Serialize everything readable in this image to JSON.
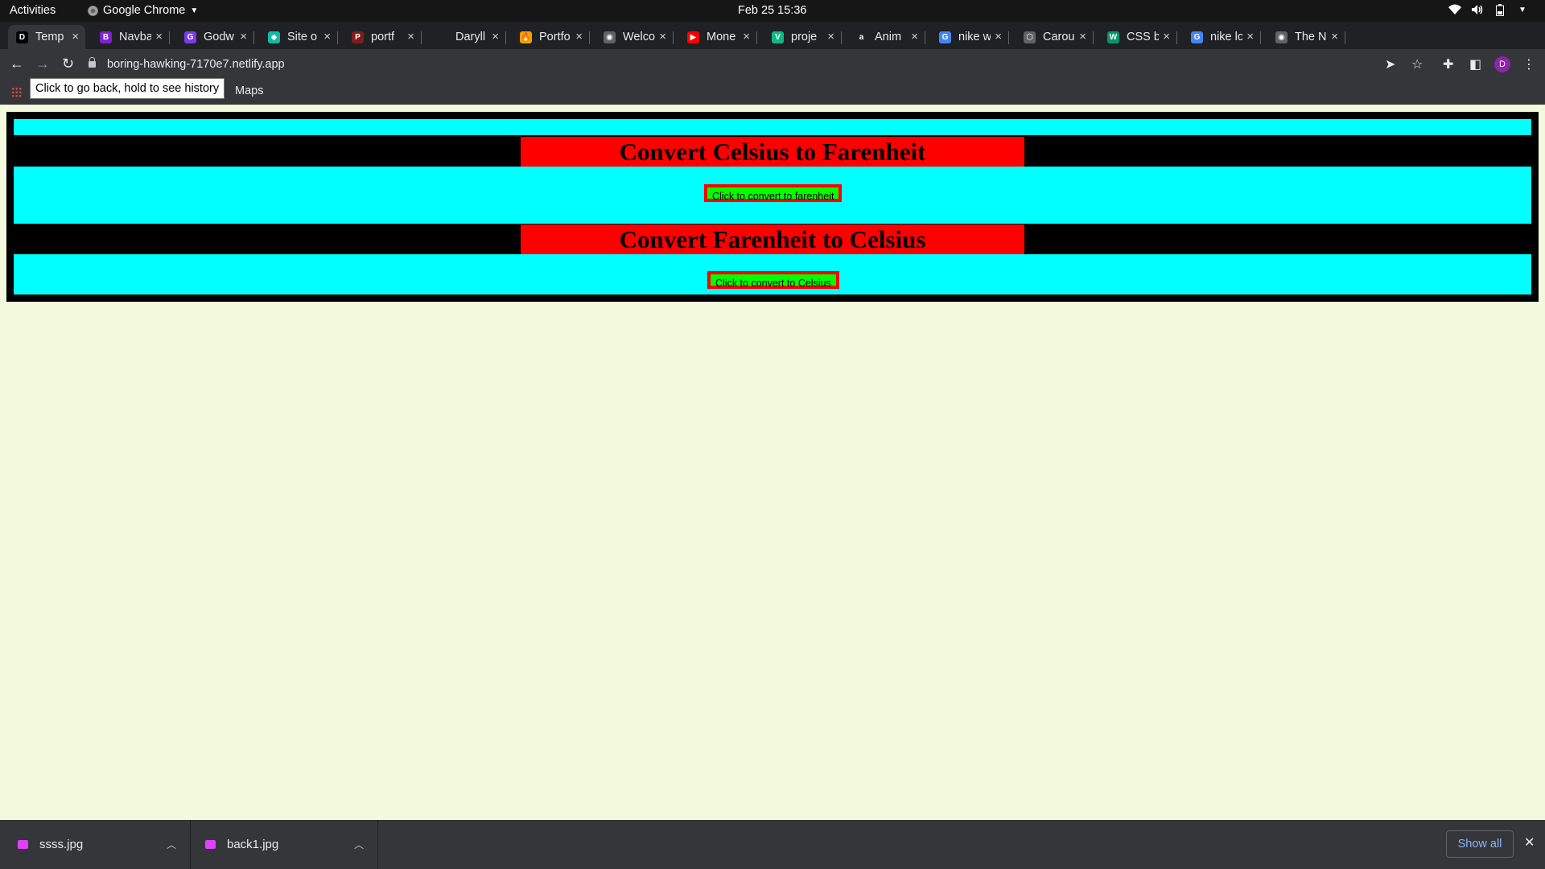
{
  "system_bar": {
    "activities": "Activities",
    "app_name": "Google Chrome",
    "clock": "Feb 25  15:36"
  },
  "tabs": [
    {
      "label": "Temp",
      "favicon": "D",
      "fav_color": "#000000",
      "active": true
    },
    {
      "label": "Navba",
      "favicon": "B",
      "fav_color": "#7e22ce"
    },
    {
      "label": "Godw",
      "favicon": "G",
      "fav_color": "#7c3aed"
    },
    {
      "label": "Site o",
      "favicon": "◆",
      "fav_color": "#14b8a6"
    },
    {
      "label": "portf",
      "favicon": "P",
      "fav_color": "#7f1d1d"
    },
    {
      "label": "Daryll",
      "favicon": "",
      "fav_color": "#202124"
    },
    {
      "label": "Portfo",
      "favicon": "🔥",
      "fav_color": "#f59e0b"
    },
    {
      "label": "Welco",
      "favicon": "◉",
      "fav_color": "#5f6368"
    },
    {
      "label": "Mone",
      "favicon": "▶",
      "fav_color": "#ff0000"
    },
    {
      "label": "proje",
      "favicon": "V",
      "fav_color": "#10b981"
    },
    {
      "label": "Anim",
      "favicon": "a",
      "fav_color": "#202124"
    },
    {
      "label": "nike w",
      "favicon": "G",
      "fav_color": "#4285f4"
    },
    {
      "label": "Carou",
      "favicon": "⬡",
      "fav_color": "#5f6368"
    },
    {
      "label": "CSS b",
      "favicon": "W",
      "fav_color": "#059669"
    },
    {
      "label": "nike lo",
      "favicon": "G",
      "fav_color": "#4285f4"
    },
    {
      "label": "The N",
      "favicon": "◉",
      "fav_color": "#5f6368"
    }
  ],
  "address_bar": {
    "url": "boring-hawking-7170e7.netlify.app",
    "profile_initial": "D"
  },
  "bookmarks": {
    "maps": "Maps"
  },
  "tooltip": "Click to go back, hold to see history",
  "page": {
    "section1": {
      "heading": "Convert Celsius to Farenheit",
      "button": "Click to convert to farenheit"
    },
    "section2": {
      "heading": "Convert Farenheit to Celsius",
      "button": "Click to convert to Celsius"
    }
  },
  "downloads": {
    "items": [
      {
        "name": "ssss.jpg"
      },
      {
        "name": "back1.jpg"
      }
    ],
    "show_all": "Show all"
  },
  "colors": {
    "page_bg": "#f2f9dc",
    "cyan": "#00ffff",
    "red": "#ff0000",
    "green": "#00ff00",
    "black": "#000000"
  }
}
